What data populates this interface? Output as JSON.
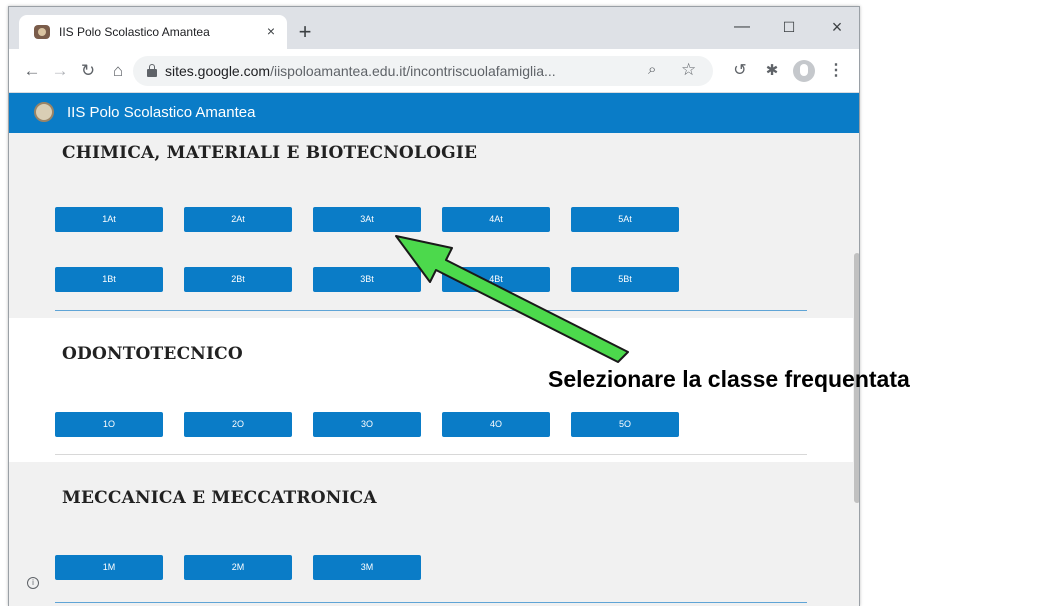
{
  "browser": {
    "tab_title": "IIS Polo Scolastico Amantea",
    "tab_close": "×",
    "new_tab": "+",
    "win_minimize": "—",
    "win_maximize": "☐",
    "win_close": "×",
    "url_host": "sites.google.com",
    "url_path": "/iispoloamantea.edu.it/incontriscuolafamiglia..."
  },
  "site": {
    "name": "IIS Polo Scolastico Amantea"
  },
  "sections": {
    "chimica": {
      "title": "CHIMICA, MATERIALI E BIOTECNOLOGIE",
      "row1": [
        "1At",
        "2At",
        "3At",
        "4At",
        "5At"
      ],
      "row2": [
        "1Bt",
        "2Bt",
        "3Bt",
        "4Bt",
        "5Bt"
      ]
    },
    "odonto": {
      "title": "ODONTOTECNICO",
      "row1": [
        "1O",
        "2O",
        "3O",
        "4O",
        "5O"
      ]
    },
    "mecc": {
      "title": "MECCANICA E MECCATRONICA",
      "row1": [
        "1M",
        "2M",
        "3M"
      ]
    }
  },
  "annotation": {
    "text": "Selezionare la classe frequentata",
    "arrow_color": "#4cd94c"
  },
  "colors": {
    "header": "#0a7cc7",
    "button": "#0a7cc7"
  }
}
